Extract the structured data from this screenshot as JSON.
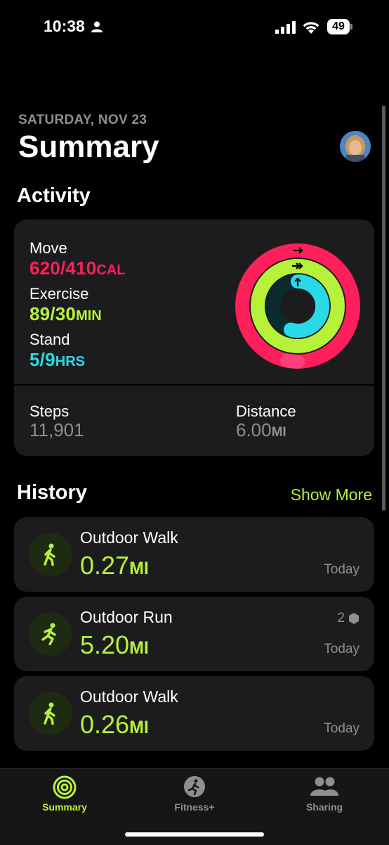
{
  "status_bar": {
    "time": "10:38",
    "battery": "49"
  },
  "header": {
    "date": "SATURDAY, NOV 23",
    "title": "Summary"
  },
  "activity": {
    "section_title": "Activity",
    "move": {
      "label": "Move",
      "value": "620/410",
      "unit": "CAL",
      "color": "#ff1f5a",
      "progress": 1.51
    },
    "exercise": {
      "label": "Exercise",
      "value": "89/30",
      "unit": "MIN",
      "color": "#b6f23a",
      "progress": 2.97
    },
    "stand": {
      "label": "Stand",
      "value": "5/9",
      "unit": "HRS",
      "color": "#2ad9e6",
      "progress": 0.56
    },
    "steps": {
      "label": "Steps",
      "value": "11,901"
    },
    "distance": {
      "label": "Distance",
      "value": "6.00",
      "unit": "MI"
    }
  },
  "history": {
    "section_title": "History",
    "show_more": "Show More",
    "items": [
      {
        "title": "Outdoor Walk",
        "value": "0.27",
        "unit": "MI",
        "date": "Today",
        "icon": "walk-icon",
        "badge": ""
      },
      {
        "title": "Outdoor Run",
        "value": "5.20",
        "unit": "MI",
        "date": "Today",
        "icon": "run-icon",
        "badge": "2"
      },
      {
        "title": "Outdoor Walk",
        "value": "0.26",
        "unit": "MI",
        "date": "Today",
        "icon": "walk-icon",
        "badge": ""
      }
    ]
  },
  "tabs": [
    {
      "label": "Summary",
      "active": true,
      "icon": "rings-icon"
    },
    {
      "label": "Fitness+",
      "active": false,
      "icon": "fitness-plus-icon"
    },
    {
      "label": "Sharing",
      "active": false,
      "icon": "sharing-icon"
    }
  ],
  "colors": {
    "accent": "#b6f23a",
    "move": "#ff1f5a",
    "exercise": "#b6f23a",
    "stand": "#2ad9e6",
    "card": "#1c1c1e"
  }
}
